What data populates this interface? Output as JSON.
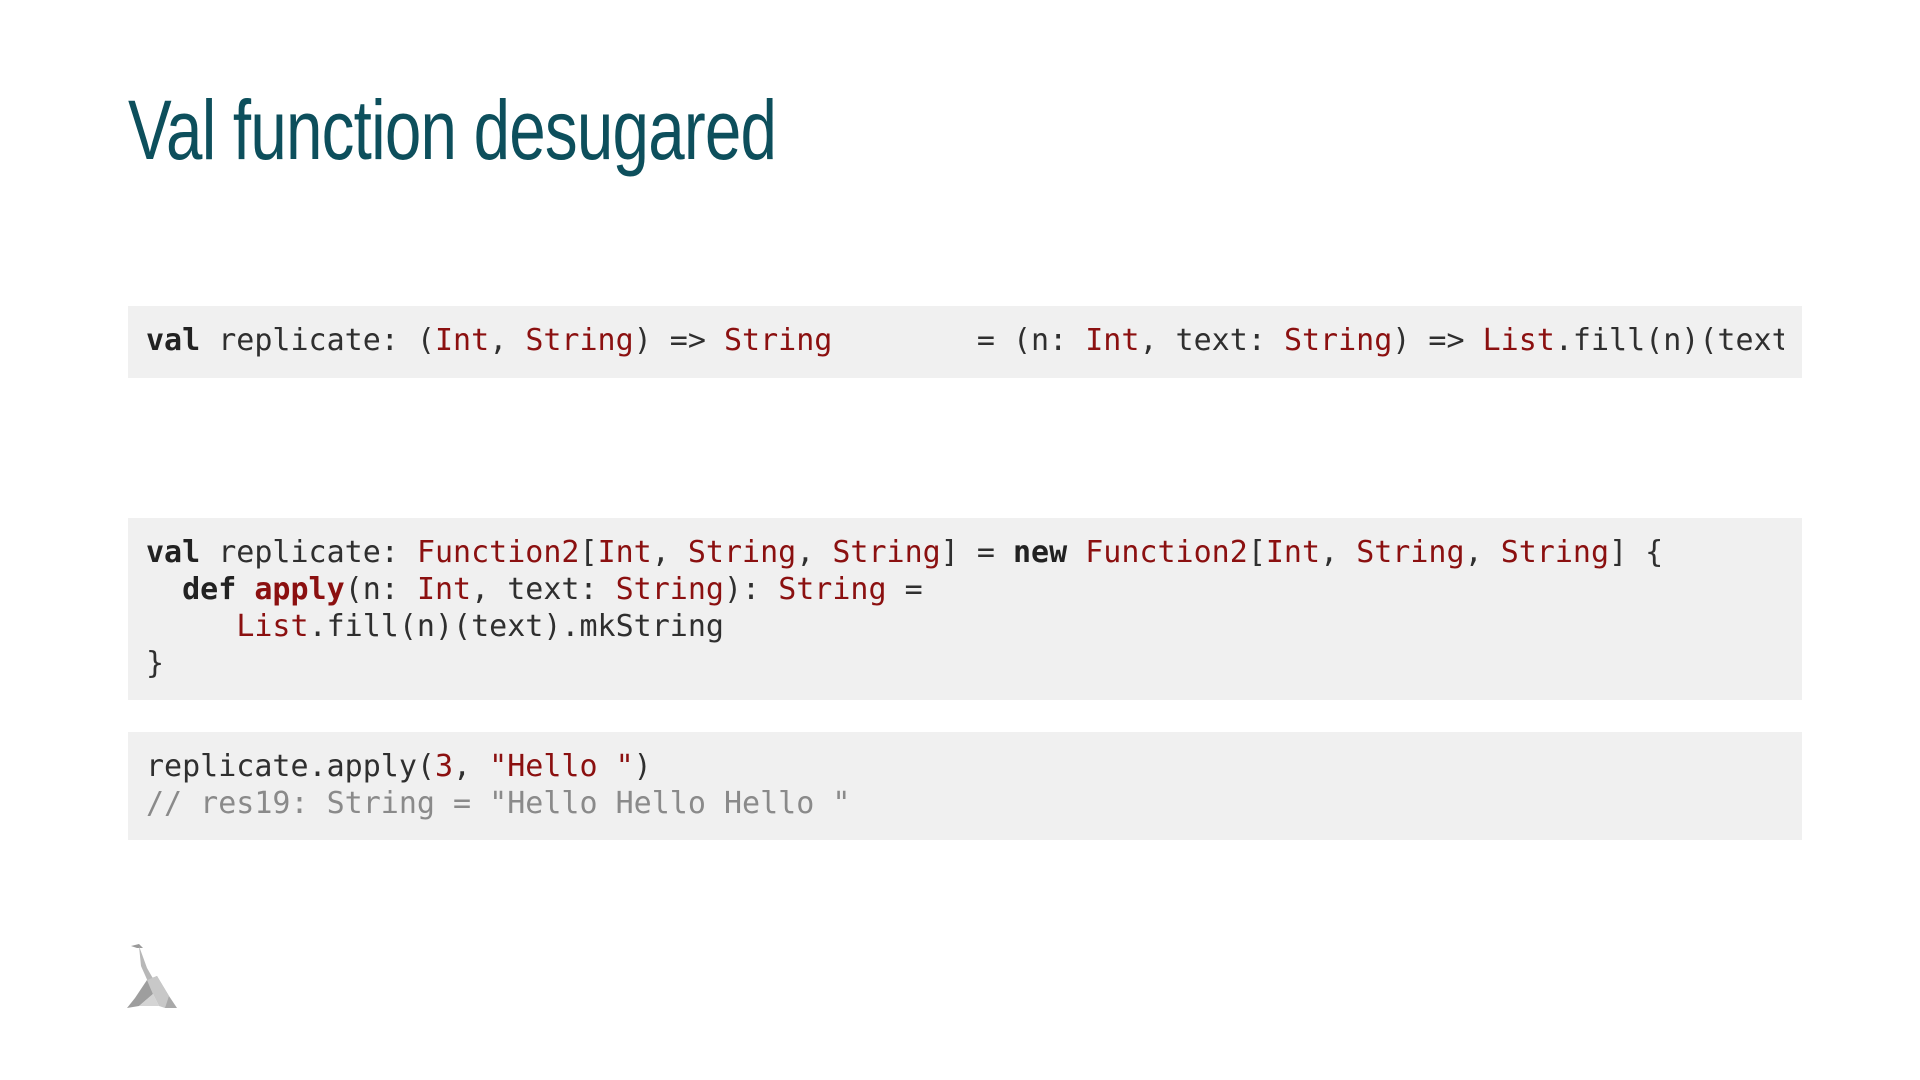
{
  "slide": {
    "title": "Val function desugared"
  },
  "block1": {
    "line1": {
      "t1": "val",
      "t2": " replicate: (",
      "t3": "Int",
      "t4": ", ",
      "t5": "String",
      "t6": ") => ",
      "t7": "String",
      "t8": "        = (n: ",
      "t9": "Int",
      "t10": ", text: ",
      "t11": "String",
      "t12": ") => ",
      "t13": "List",
      "t14": ".fill(n)(text).mk"
    }
  },
  "block2": {
    "line1": {
      "t1": "val",
      "t2": " replicate: ",
      "t3": "Function2",
      "t4": "[",
      "t5": "Int",
      "t6": ", ",
      "t7": "String",
      "t8": ", ",
      "t9": "String",
      "t10": "] = ",
      "t11": "new",
      "t12": " ",
      "t13": "Function2",
      "t14": "[",
      "t15": "Int",
      "t16": ", ",
      "t17": "String",
      "t18": ", ",
      "t19": "String",
      "t20": "] {"
    },
    "line2": {
      "t1": "  ",
      "t2": "def",
      "t3": " ",
      "t4": "apply",
      "t5": "(n: ",
      "t6": "Int",
      "t7": ", text: ",
      "t8": "String",
      "t9": "): ",
      "t10": "String",
      "t11": " ="
    },
    "line3": {
      "t1": "     ",
      "t2": "List",
      "t3": ".fill(n)(text).mkString"
    },
    "line4": {
      "t1": "}"
    }
  },
  "block3": {
    "line1": {
      "t1": "replicate.apply(",
      "t2": "3",
      "t3": ", ",
      "t4": "\"Hello \"",
      "t5": ")"
    },
    "line2": {
      "t1": "// res19: String = \"Hello Hello Hello \""
    }
  },
  "colors": {
    "title": "#0d4f5c",
    "code_background": "#f0f0f0",
    "type_highlight": "#8b1010",
    "comment": "#8a8a8a"
  },
  "icons": {
    "logo": "lambda-logo-icon"
  }
}
